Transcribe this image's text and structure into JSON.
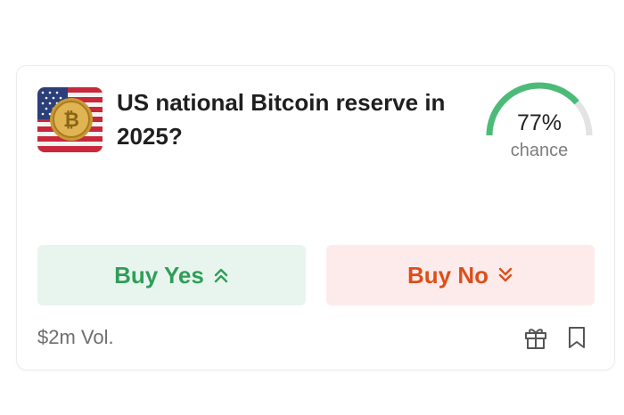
{
  "market": {
    "title": "US national Bitcoin reserve in 2025?",
    "chance": {
      "percent_label": "77%",
      "label": "chance",
      "value": 0.77
    },
    "buttons": {
      "yes": "Buy Yes",
      "no": "Buy No"
    },
    "volume": "$2m Vol."
  },
  "colors": {
    "yes_text": "#2f9e58",
    "yes_bg": "#e8f5ee",
    "no_text": "#dc4f1a",
    "no_bg": "#fdebeb",
    "gauge_fill": "#4cbb78",
    "gauge_track": "#e3e3e3"
  },
  "icons": {
    "thumbnail": "bitcoin-flag-thumbnail",
    "yes_arrow": "double-chevron-up-icon",
    "no_arrow": "double-chevron-down-icon",
    "gift": "gift-icon",
    "bookmark": "bookmark-icon"
  }
}
